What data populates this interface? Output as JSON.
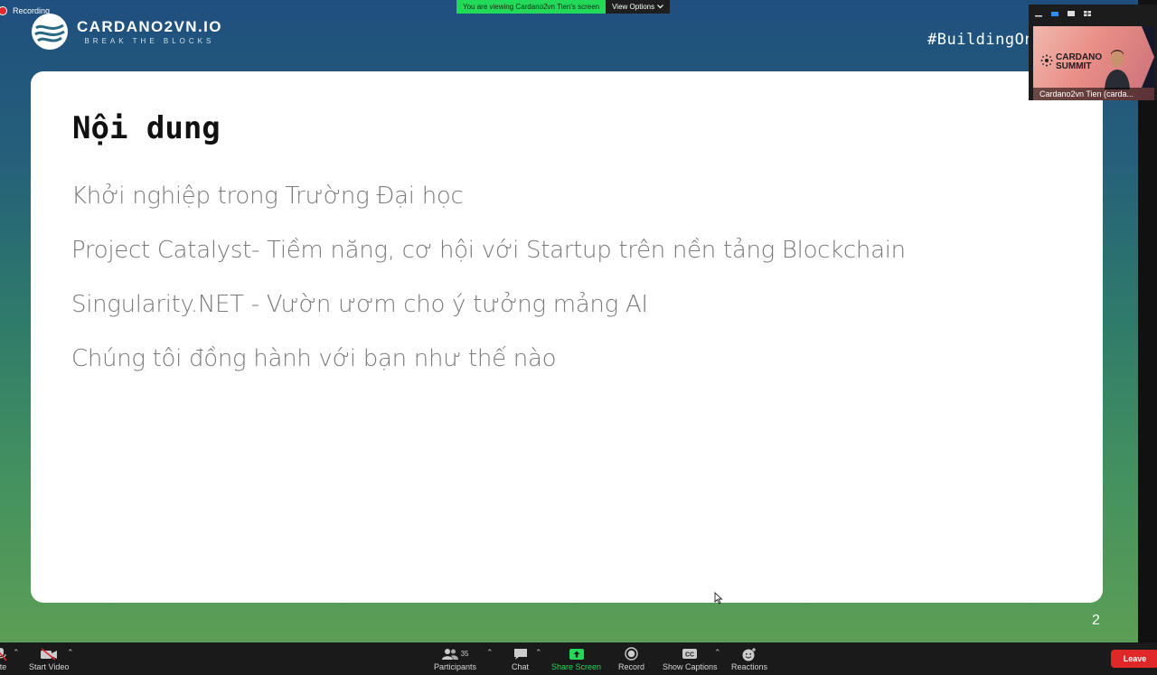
{
  "recording": {
    "label": "Recording"
  },
  "share_banner": {
    "message": "You are viewing Cardano2vn Tien's screen",
    "view_options": "View Options"
  },
  "logo": {
    "title": "CARDANO2VN.IO",
    "subtitle": "BREAK THE BLOCKS"
  },
  "hashtag": "#BuildingOn",
  "slide": {
    "title": "Nội dung",
    "bullets": [
      "Khởi nghiệp trong Trường Đại học",
      "Project Catalyst- Tiềm năng, cơ hội với Startup trên nền tảng Blockchain",
      "Singularity.NET - Vườn ươm cho ý tưởng mảng AI",
      "Chúng tôi đồng hành với bạn như thế nào"
    ],
    "page_number": "2"
  },
  "speaker_video": {
    "name": "Cardano2vn Tien (carda...",
    "background_text": [
      "CARDANO",
      "SUMMIT"
    ]
  },
  "toolbar": {
    "mute_label": "ute",
    "start_video_label": "Start Video",
    "participants_label": "Participants",
    "participants_count": "35",
    "chat_label": "Chat",
    "share_screen_label": "Share Screen",
    "record_label": "Record",
    "show_captions_label": "Show Captions",
    "reactions_label": "Reactions",
    "leave_label": "Leave"
  },
  "colors": {
    "share_green": "#23d959",
    "leave_red": "#e02828",
    "toolbar_bg": "#1a1a1a",
    "slide_text": "#7a7a7a"
  }
}
